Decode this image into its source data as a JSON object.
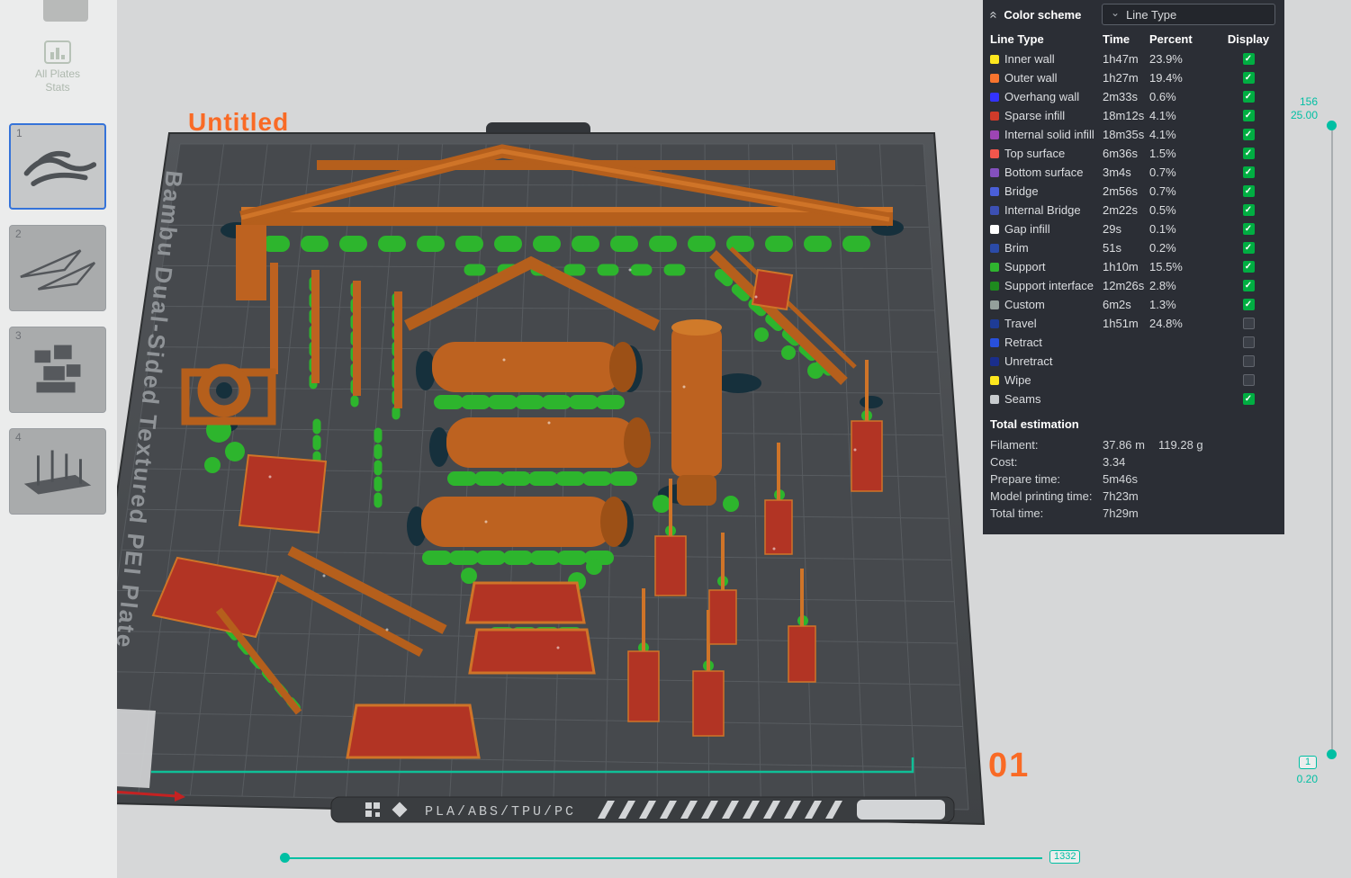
{
  "app": {
    "colors": {
      "accent_orange": "#f96a25",
      "checkbox_green": "#00ae42",
      "slider_teal": "#00bfa3",
      "panel_bg": "#2b2e35"
    }
  },
  "sidebar": {
    "all_plates": {
      "line1": "All Plates",
      "line2": "Stats"
    },
    "plates": [
      {
        "number": "1",
        "selected": true
      },
      {
        "number": "2",
        "selected": false
      },
      {
        "number": "3",
        "selected": false
      },
      {
        "number": "4",
        "selected": false
      }
    ]
  },
  "viewport": {
    "project_title": "Untitled",
    "plate_side_label": "Bambu Dual-Sided Textured PEI Plate",
    "plate_materials": "PLA/ABS/TPU/PC",
    "plate_number": "01"
  },
  "color_scheme": {
    "collapse_icon": "«",
    "title": "Color scheme",
    "dropdown": {
      "value": "Line Type",
      "chevron": "⌄"
    },
    "columns": [
      "Line Type",
      "Time",
      "Percent",
      "Display"
    ],
    "rows": [
      {
        "label": "Inner wall",
        "time": "1h47m",
        "percent": "23.9%",
        "checked": true,
        "color": "#fde71e"
      },
      {
        "label": "Outer wall",
        "time": "1h27m",
        "percent": "19.4%",
        "checked": true,
        "color": "#f8742e"
      },
      {
        "label": "Overhang wall",
        "time": "2m33s",
        "percent": "0.6%",
        "checked": true,
        "color": "#3333ff"
      },
      {
        "label": "Sparse infill",
        "time": "18m12s",
        "percent": "4.1%",
        "checked": true,
        "color": "#cf3b2a"
      },
      {
        "label": "Internal solid infill",
        "time": "18m35s",
        "percent": "4.1%",
        "checked": true,
        "color": "#9d45b4"
      },
      {
        "label": "Top surface",
        "time": "6m36s",
        "percent": "1.5%",
        "checked": true,
        "color": "#f2564c"
      },
      {
        "label": "Bottom surface",
        "time": "3m4s",
        "percent": "0.7%",
        "checked": true,
        "color": "#8450be"
      },
      {
        "label": "Bridge",
        "time": "2m56s",
        "percent": "0.7%",
        "checked": true,
        "color": "#4a5fd8"
      },
      {
        "label": "Internal Bridge",
        "time": "2m22s",
        "percent": "0.5%",
        "checked": true,
        "color": "#3c50b4"
      },
      {
        "label": "Gap infill",
        "time": "29s",
        "percent": "0.1%",
        "checked": true,
        "color": "#ffffff"
      },
      {
        "label": "Brim",
        "time": "51s",
        "percent": "0.2%",
        "checked": true,
        "color": "#2b4ba8"
      },
      {
        "label": "Support",
        "time": "1h10m",
        "percent": "15.5%",
        "checked": true,
        "color": "#2fb52f"
      },
      {
        "label": "Support interface",
        "time": "12m26s",
        "percent": "2.8%",
        "checked": true,
        "color": "#1e8a1e"
      },
      {
        "label": "Custom",
        "time": "6m2s",
        "percent": "1.3%",
        "checked": true,
        "color": "#94a09b"
      },
      {
        "label": "Travel",
        "time": "1h51m",
        "percent": "24.8%",
        "checked": false,
        "color": "#1e3c96"
      },
      {
        "label": "Retract",
        "time": "",
        "percent": "",
        "checked": false,
        "color": "#2850dc"
      },
      {
        "label": "Unretract",
        "time": "",
        "percent": "",
        "checked": false,
        "color": "#1a2e8c"
      },
      {
        "label": "Wipe",
        "time": "",
        "percent": "",
        "checked": false,
        "color": "#fde71e"
      },
      {
        "label": "Seams",
        "time": "",
        "percent": "",
        "checked": true,
        "color": "#c8cccf"
      }
    ]
  },
  "total_estimation": {
    "title": "Total estimation",
    "rows": [
      {
        "label": "Filament:",
        "value": "37.86 m",
        "value2": "119.28 g"
      },
      {
        "label": "Cost:",
        "value": "3.34",
        "value2": ""
      },
      {
        "label": "Prepare time:",
        "value": "5m46s",
        "value2": ""
      },
      {
        "label": "Model printing time:",
        "value": "7h23m",
        "value2": ""
      },
      {
        "label": "Total time:",
        "value": "7h29m",
        "value2": ""
      }
    ]
  },
  "layer_slider": {
    "top_layer": "156",
    "top_height": "25.00",
    "bottom_layer": "1",
    "bottom_height": "0.20"
  },
  "time_slider": {
    "value": "1332"
  }
}
